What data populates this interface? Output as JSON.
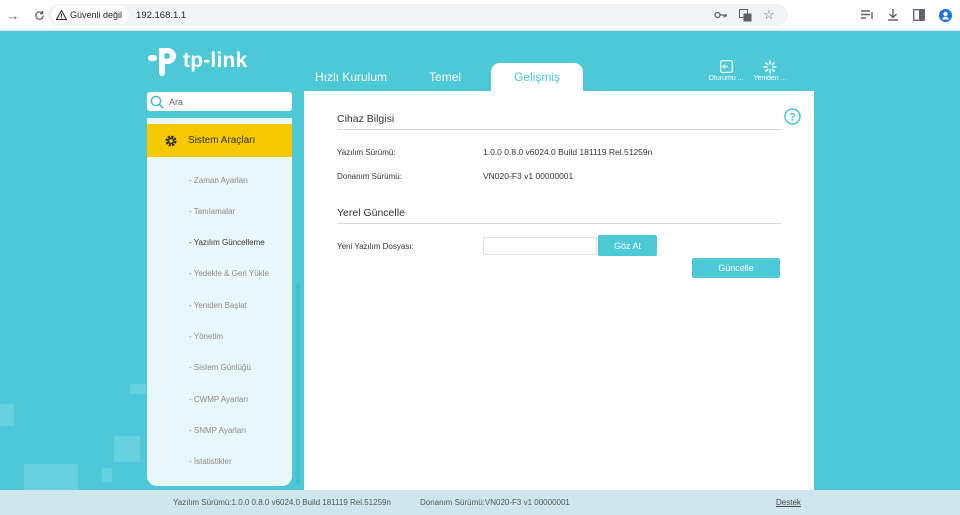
{
  "browser": {
    "security_label": "Güvenli değil",
    "url": "192.168.1.1"
  },
  "header": {
    "logo_text": "tp-link",
    "tabs": [
      {
        "label": "Hızlı Kurulum"
      },
      {
        "label": "Temel"
      },
      {
        "label": "Gelişmiş"
      }
    ],
    "logout_label": "Oturumu ...",
    "reboot_label": "Yeniden ..."
  },
  "sidebar": {
    "search_placeholder": "Ara",
    "section_label": "Sistem Araçları",
    "items": [
      {
        "label": "- Zaman Ayarları"
      },
      {
        "label": "- Tanılamalar"
      },
      {
        "label": "- Yazılım Güncelleme"
      },
      {
        "label": "- Yedekle & Geri Yükle"
      },
      {
        "label": "- Yeniden Başlat"
      },
      {
        "label": "- Yönetim"
      },
      {
        "label": "- Sistem Günlüğü"
      },
      {
        "label": "- CWMP Ayarları"
      },
      {
        "label": "- SNMP Ayarları"
      },
      {
        "label": "- İstatistikler"
      }
    ],
    "active_index": 2
  },
  "main": {
    "device_info_title": "Cihaz Bilgisi",
    "firmware_label": "Yazılım Sürümü:",
    "firmware_value": "1.0.0 0.8.0 v6024.0 Build 181119 Rel.51259n",
    "hardware_label": "Donanım Sürümü:",
    "hardware_value": "VN020-F3 v1 00000001",
    "local_update_title": "Yerel Güncelle",
    "new_file_label": "Yeni Yazılım Dosyası:",
    "browse_label": "Göz At",
    "update_label": "Güncelle"
  },
  "footer": {
    "firmware_text": "Yazılım Sürümü:1.0.0 0.8.0 v6024.0 Build 181119 Rel.51259n",
    "hardware_text": "Donanım Sürümü:VN020-F3 v1 00000001",
    "support_label": "Destek"
  },
  "colors": {
    "brand": "#4cc8d7",
    "active_menu": "#f5c800"
  }
}
